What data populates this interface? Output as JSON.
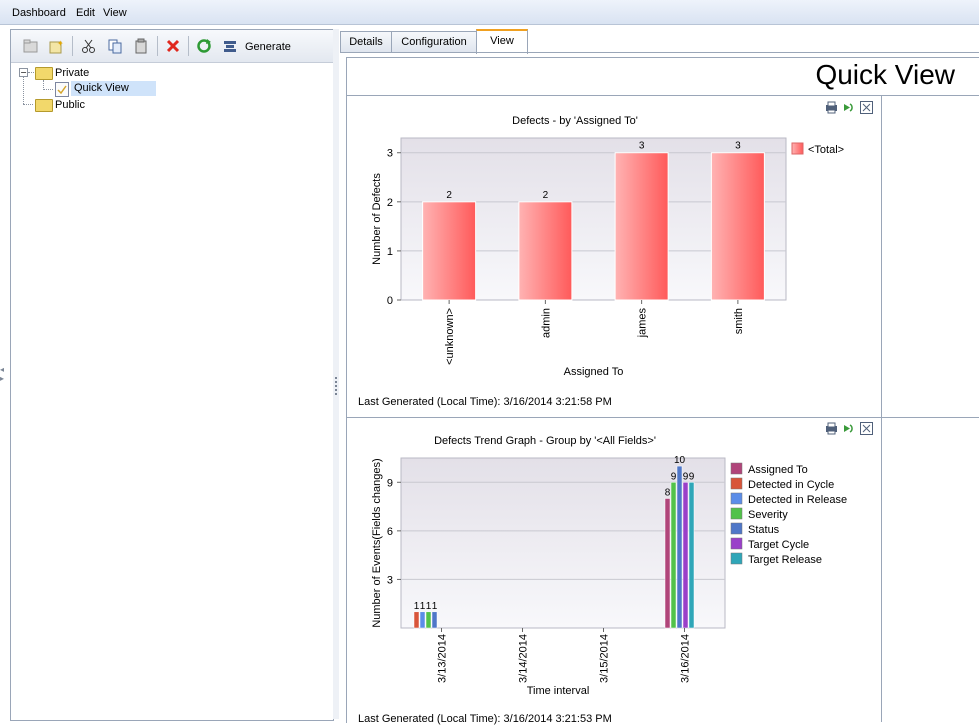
{
  "menu": {
    "items": [
      {
        "label": "Dashboard"
      },
      {
        "label": "Edit"
      },
      {
        "label": "View"
      }
    ]
  },
  "toolbar": {
    "generate_label": "Generate",
    "icons": [
      "new-folder-icon",
      "new-page-icon",
      "cut-icon",
      "copy-icon",
      "paste-icon",
      "delete-icon",
      "refresh-icon",
      "generate-icon"
    ]
  },
  "tree": {
    "private_label": "Private",
    "quick_view_label": "Quick View",
    "public_label": "Public"
  },
  "tabs": [
    {
      "label": "Details"
    },
    {
      "label": "Configuration"
    },
    {
      "label": "View",
      "active": true
    }
  ],
  "page": {
    "title": "Quick View"
  },
  "graphs": [
    {
      "title": "Defects - by 'Assigned To'",
      "last_generated": "Last Generated (Local Time): 3/16/2014 3:21:58 PM"
    },
    {
      "title": "Defects Trend Graph - Group by '<All Fields>'",
      "last_generated": "Last Generated (Local Time): 3/16/2014 3:21:53 PM"
    }
  ],
  "chart_data": [
    {
      "type": "bar",
      "title": "Defects - by 'Assigned To'",
      "xlabel": "Assigned To",
      "ylabel": "Number of Defects",
      "categories": [
        "<unknown>",
        "admin",
        "james",
        "smith"
      ],
      "series": [
        {
          "name": "<Total>",
          "values": [
            2,
            2,
            3,
            3
          ]
        }
      ],
      "ylim": [
        0,
        3.3
      ],
      "yticks": [
        0,
        1,
        2,
        3
      ],
      "legend": "right",
      "grid": true,
      "color": "#ff6b6b"
    },
    {
      "type": "bar",
      "title": "Defects Trend Graph - Group by '<All Fields>'",
      "xlabel": "Time interval",
      "ylabel": "Number of Events(Fields changes)",
      "categories": [
        "3/13/2014",
        "3/14/2014",
        "3/15/2014",
        "3/16/2014"
      ],
      "series": [
        {
          "name": "Assigned To",
          "color": "#b0457a",
          "values": [
            0,
            0,
            0,
            8
          ]
        },
        {
          "name": "Detected in Cycle",
          "color": "#d8553a",
          "values": [
            1,
            0,
            0,
            0
          ]
        },
        {
          "name": "Detected in Release",
          "color": "#5b8de8",
          "values": [
            1,
            0,
            0,
            0
          ]
        },
        {
          "name": "Severity",
          "color": "#52c24a",
          "values": [
            1,
            0,
            0,
            9
          ]
        },
        {
          "name": "Status",
          "color": "#4f77c8",
          "values": [
            1,
            0,
            0,
            10
          ]
        },
        {
          "name": "Target Cycle",
          "color": "#9a3fc9",
          "values": [
            0,
            0,
            0,
            9
          ]
        },
        {
          "name": "Target Release",
          "color": "#2fa6b8",
          "values": [
            0,
            0,
            0,
            9
          ]
        }
      ],
      "ylim": [
        0,
        10.5
      ],
      "yticks": [
        3,
        6,
        9
      ],
      "legend": "right",
      "grid": true
    }
  ]
}
